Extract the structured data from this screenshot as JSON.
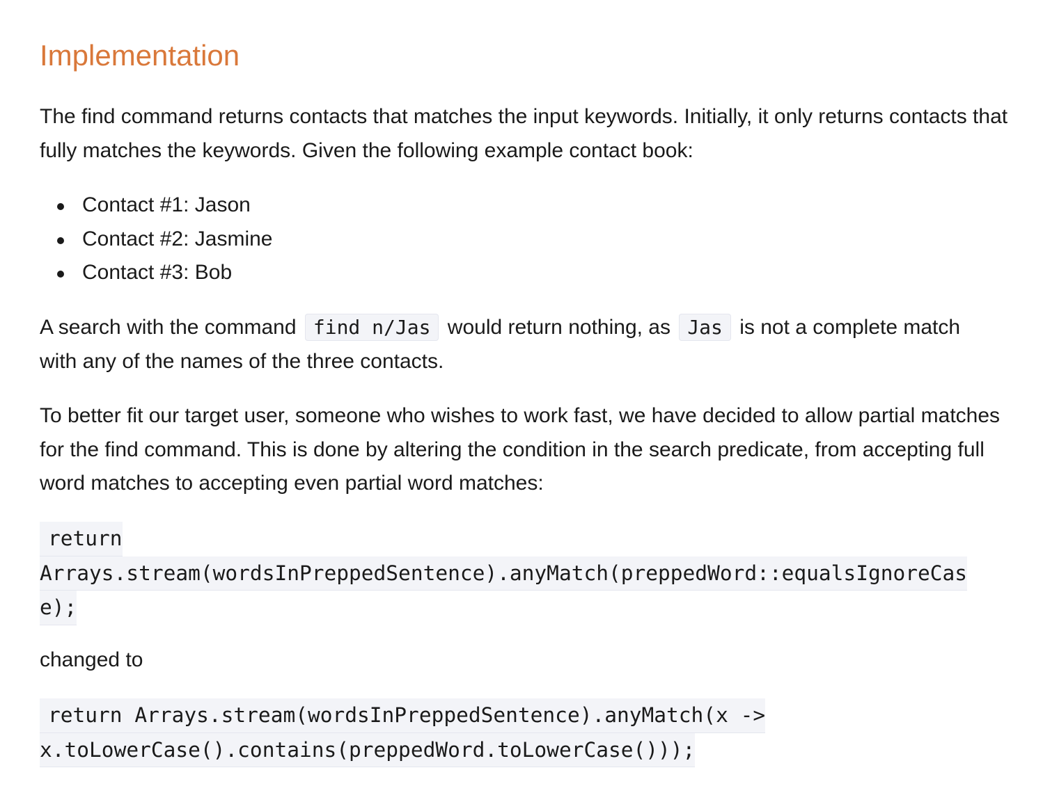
{
  "heading": "Implementation",
  "intro": {
    "text": "The find command returns contacts that matches the input keywords. Initially, it only returns contacts that fully matches the keywords. Given the following example contact book:"
  },
  "contacts": [
    "Contact #1: Jason",
    "Contact #2: Jasmine",
    "Contact #3: Bob"
  ],
  "search_para": {
    "before": "A search with the command",
    "code1": "find n/Jas",
    "middle": "would return nothing, as",
    "code2": "Jas",
    "after": "is not a complete match with any of the names of the three contacts."
  },
  "partial_para": {
    "text": "To better fit our target user, someone who wishes to work fast, we have decided to allow partial matches for the find command. This is done by altering the condition in the search predicate, from accepting full word matches to accepting even partial word matches:"
  },
  "code_before": {
    "line1": "return",
    "line2": "Arrays.stream(wordsInPreppedSentence).anyMatch(preppedWord::equalsIgnoreCas",
    "line3": "e);"
  },
  "changed_to": "changed to",
  "code_after": {
    "line1": "return Arrays.stream(wordsInPreppedSentence).anyMatch(x ->",
    "line2": "x.toLowerCase().contains(preppedWord.toLowerCase()));"
  }
}
